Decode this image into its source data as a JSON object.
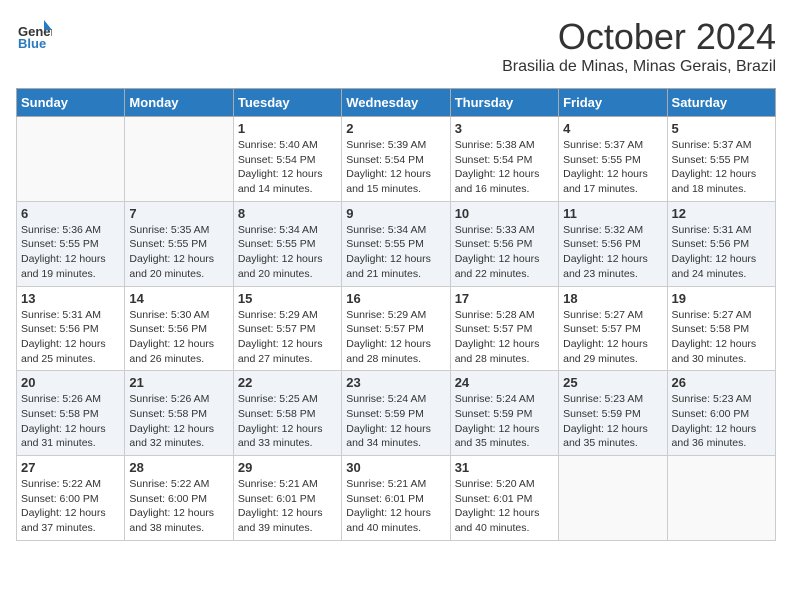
{
  "header": {
    "logo_general": "General",
    "logo_blue": "Blue",
    "month": "October 2024",
    "location": "Brasilia de Minas, Minas Gerais, Brazil"
  },
  "weekdays": [
    "Sunday",
    "Monday",
    "Tuesday",
    "Wednesday",
    "Thursday",
    "Friday",
    "Saturday"
  ],
  "weeks": [
    [
      {
        "day": "",
        "sunrise": "",
        "sunset": "",
        "daylight": ""
      },
      {
        "day": "",
        "sunrise": "",
        "sunset": "",
        "daylight": ""
      },
      {
        "day": "1",
        "sunrise": "Sunrise: 5:40 AM",
        "sunset": "Sunset: 5:54 PM",
        "daylight": "Daylight: 12 hours and 14 minutes."
      },
      {
        "day": "2",
        "sunrise": "Sunrise: 5:39 AM",
        "sunset": "Sunset: 5:54 PM",
        "daylight": "Daylight: 12 hours and 15 minutes."
      },
      {
        "day": "3",
        "sunrise": "Sunrise: 5:38 AM",
        "sunset": "Sunset: 5:54 PM",
        "daylight": "Daylight: 12 hours and 16 minutes."
      },
      {
        "day": "4",
        "sunrise": "Sunrise: 5:37 AM",
        "sunset": "Sunset: 5:55 PM",
        "daylight": "Daylight: 12 hours and 17 minutes."
      },
      {
        "day": "5",
        "sunrise": "Sunrise: 5:37 AM",
        "sunset": "Sunset: 5:55 PM",
        "daylight": "Daylight: 12 hours and 18 minutes."
      }
    ],
    [
      {
        "day": "6",
        "sunrise": "Sunrise: 5:36 AM",
        "sunset": "Sunset: 5:55 PM",
        "daylight": "Daylight: 12 hours and 19 minutes."
      },
      {
        "day": "7",
        "sunrise": "Sunrise: 5:35 AM",
        "sunset": "Sunset: 5:55 PM",
        "daylight": "Daylight: 12 hours and 20 minutes."
      },
      {
        "day": "8",
        "sunrise": "Sunrise: 5:34 AM",
        "sunset": "Sunset: 5:55 PM",
        "daylight": "Daylight: 12 hours and 20 minutes."
      },
      {
        "day": "9",
        "sunrise": "Sunrise: 5:34 AM",
        "sunset": "Sunset: 5:55 PM",
        "daylight": "Daylight: 12 hours and 21 minutes."
      },
      {
        "day": "10",
        "sunrise": "Sunrise: 5:33 AM",
        "sunset": "Sunset: 5:56 PM",
        "daylight": "Daylight: 12 hours and 22 minutes."
      },
      {
        "day": "11",
        "sunrise": "Sunrise: 5:32 AM",
        "sunset": "Sunset: 5:56 PM",
        "daylight": "Daylight: 12 hours and 23 minutes."
      },
      {
        "day": "12",
        "sunrise": "Sunrise: 5:31 AM",
        "sunset": "Sunset: 5:56 PM",
        "daylight": "Daylight: 12 hours and 24 minutes."
      }
    ],
    [
      {
        "day": "13",
        "sunrise": "Sunrise: 5:31 AM",
        "sunset": "Sunset: 5:56 PM",
        "daylight": "Daylight: 12 hours and 25 minutes."
      },
      {
        "day": "14",
        "sunrise": "Sunrise: 5:30 AM",
        "sunset": "Sunset: 5:56 PM",
        "daylight": "Daylight: 12 hours and 26 minutes."
      },
      {
        "day": "15",
        "sunrise": "Sunrise: 5:29 AM",
        "sunset": "Sunset: 5:57 PM",
        "daylight": "Daylight: 12 hours and 27 minutes."
      },
      {
        "day": "16",
        "sunrise": "Sunrise: 5:29 AM",
        "sunset": "Sunset: 5:57 PM",
        "daylight": "Daylight: 12 hours and 28 minutes."
      },
      {
        "day": "17",
        "sunrise": "Sunrise: 5:28 AM",
        "sunset": "Sunset: 5:57 PM",
        "daylight": "Daylight: 12 hours and 28 minutes."
      },
      {
        "day": "18",
        "sunrise": "Sunrise: 5:27 AM",
        "sunset": "Sunset: 5:57 PM",
        "daylight": "Daylight: 12 hours and 29 minutes."
      },
      {
        "day": "19",
        "sunrise": "Sunrise: 5:27 AM",
        "sunset": "Sunset: 5:58 PM",
        "daylight": "Daylight: 12 hours and 30 minutes."
      }
    ],
    [
      {
        "day": "20",
        "sunrise": "Sunrise: 5:26 AM",
        "sunset": "Sunset: 5:58 PM",
        "daylight": "Daylight: 12 hours and 31 minutes."
      },
      {
        "day": "21",
        "sunrise": "Sunrise: 5:26 AM",
        "sunset": "Sunset: 5:58 PM",
        "daylight": "Daylight: 12 hours and 32 minutes."
      },
      {
        "day": "22",
        "sunrise": "Sunrise: 5:25 AM",
        "sunset": "Sunset: 5:58 PM",
        "daylight": "Daylight: 12 hours and 33 minutes."
      },
      {
        "day": "23",
        "sunrise": "Sunrise: 5:24 AM",
        "sunset": "Sunset: 5:59 PM",
        "daylight": "Daylight: 12 hours and 34 minutes."
      },
      {
        "day": "24",
        "sunrise": "Sunrise: 5:24 AM",
        "sunset": "Sunset: 5:59 PM",
        "daylight": "Daylight: 12 hours and 35 minutes."
      },
      {
        "day": "25",
        "sunrise": "Sunrise: 5:23 AM",
        "sunset": "Sunset: 5:59 PM",
        "daylight": "Daylight: 12 hours and 35 minutes."
      },
      {
        "day": "26",
        "sunrise": "Sunrise: 5:23 AM",
        "sunset": "Sunset: 6:00 PM",
        "daylight": "Daylight: 12 hours and 36 minutes."
      }
    ],
    [
      {
        "day": "27",
        "sunrise": "Sunrise: 5:22 AM",
        "sunset": "Sunset: 6:00 PM",
        "daylight": "Daylight: 12 hours and 37 minutes."
      },
      {
        "day": "28",
        "sunrise": "Sunrise: 5:22 AM",
        "sunset": "Sunset: 6:00 PM",
        "daylight": "Daylight: 12 hours and 38 minutes."
      },
      {
        "day": "29",
        "sunrise": "Sunrise: 5:21 AM",
        "sunset": "Sunset: 6:01 PM",
        "daylight": "Daylight: 12 hours and 39 minutes."
      },
      {
        "day": "30",
        "sunrise": "Sunrise: 5:21 AM",
        "sunset": "Sunset: 6:01 PM",
        "daylight": "Daylight: 12 hours and 40 minutes."
      },
      {
        "day": "31",
        "sunrise": "Sunrise: 5:20 AM",
        "sunset": "Sunset: 6:01 PM",
        "daylight": "Daylight: 12 hours and 40 minutes."
      },
      {
        "day": "",
        "sunrise": "",
        "sunset": "",
        "daylight": ""
      },
      {
        "day": "",
        "sunrise": "",
        "sunset": "",
        "daylight": ""
      }
    ]
  ]
}
